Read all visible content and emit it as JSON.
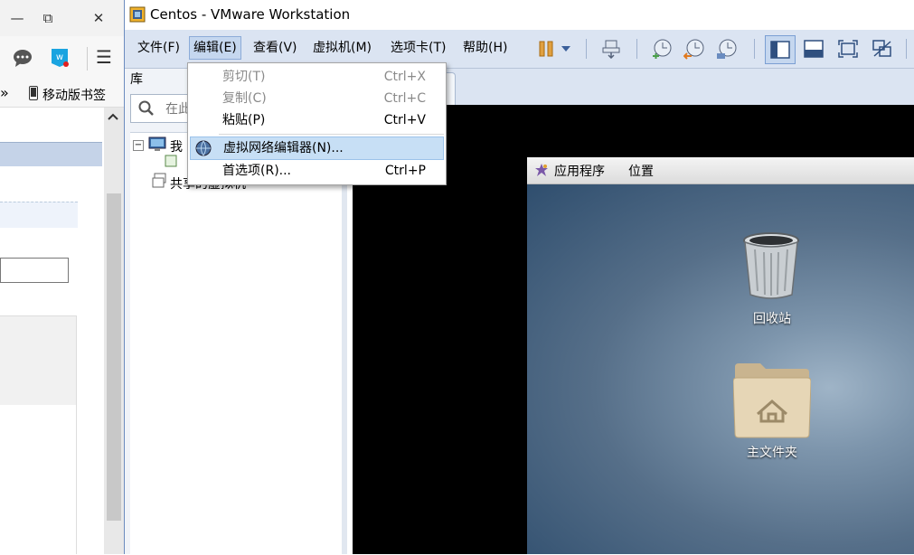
{
  "browser": {
    "window_buttons": {
      "minimize": "—",
      "restore": "⧉",
      "close": "✕"
    },
    "bookmarks": {
      "chevron": "»",
      "mobile_bookmarks": "移动版书签"
    },
    "toolbar": {
      "menu_icon": "☰"
    }
  },
  "vmware": {
    "title": "Centos - VMware Workstation",
    "menu": [
      {
        "label": "文件(F)"
      },
      {
        "label": "编辑(E)"
      },
      {
        "label": "查看(V)"
      },
      {
        "label": "虚拟机(M)"
      },
      {
        "label": "选项卡(T)"
      },
      {
        "label": "帮助(H)"
      }
    ],
    "toolbar_icons": [
      "pause-icon",
      "dropdown-arrow-icon",
      "send-ctrl-alt-del-icon",
      "snapshot-icon",
      "revert-snapshot-icon",
      "snapshot-manager-icon",
      "library-view-icon",
      "console-view-icon",
      "fullscreen-icon",
      "unity-icon"
    ],
    "library": {
      "title": "库",
      "search_placeholder": "在此",
      "tree": [
        {
          "label": "我",
          "expander": "−"
        },
        {
          "label": "共享的虚拟机"
        }
      ]
    },
    "edit_menu": {
      "items": [
        {
          "label": "剪切(T)",
          "shortcut": "Ctrl+X",
          "disabled": true
        },
        {
          "label": "复制(C)",
          "shortcut": "Ctrl+C",
          "disabled": true
        },
        {
          "label": "粘贴(P)",
          "shortcut": "Ctrl+V",
          "disabled": false
        },
        {
          "label": "虚拟网络编辑器(N)...",
          "shortcut": "",
          "disabled": false,
          "highlighted": true,
          "icon": "globe-icon"
        },
        {
          "label": "首选项(R)...",
          "shortcut": "Ctrl+P",
          "disabled": false
        }
      ]
    }
  },
  "guest": {
    "panel": {
      "applications": "应用程序",
      "places": "位置"
    },
    "desktop_icons": [
      {
        "label": "回收站",
        "icon": "trash-icon"
      },
      {
        "label": "主文件夹",
        "icon": "home-folder-icon"
      }
    ]
  }
}
